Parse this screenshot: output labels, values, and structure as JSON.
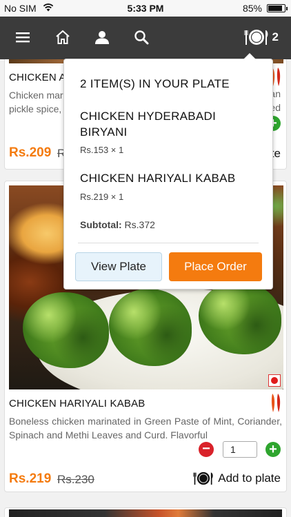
{
  "status_bar": {
    "carrier": "No SIM",
    "time": "5:33 PM",
    "battery": "85%",
    "battery_level": 0.85
  },
  "nav": {
    "plate_count": "2",
    "icons": [
      "menu-icon",
      "home-icon",
      "user-icon",
      "search-icon",
      "plate-icon"
    ]
  },
  "products": [
    {
      "title": "CHICKEN AC",
      "description": "Chicken mar",
      "description_line2": "pickle spice,",
      "price": "Rs.209",
      "mrp": "R",
      "desc_tail_1": "an",
      "desc_tail_2": "ed",
      "add_label": "te"
    },
    {
      "title": "CHICKEN HARIYALI KABAB",
      "description": "Boneless chicken marinated in Green Paste of Mint, Coriander, Spinach and Methi Leaves and Curd. Flavorful",
      "price": "Rs.219",
      "mrp": "Rs.230",
      "quantity": "1",
      "add_label": "Add to plate"
    }
  ],
  "popup": {
    "header": "2 ITEM(S) IN YOUR PLATE",
    "items": [
      {
        "name": "CHICKEN HYDERABADI BIRYANI",
        "price_line": "Rs.153 × 1"
      },
      {
        "name": "CHICKEN HARIYALI KABAB",
        "price_line": "Rs.219 × 1"
      }
    ],
    "subtotal_label": "Subtotal:",
    "subtotal_value": "Rs.372",
    "view_plate_label": "View Plate",
    "place_order_label": "Place Order"
  },
  "colors": {
    "nav_bg": "#3b3b3b",
    "accent_orange": "#f47b0f",
    "plus_green": "#2ea52e",
    "minus_red": "#d9222a",
    "view_plate_bg": "#e7f3fb"
  }
}
